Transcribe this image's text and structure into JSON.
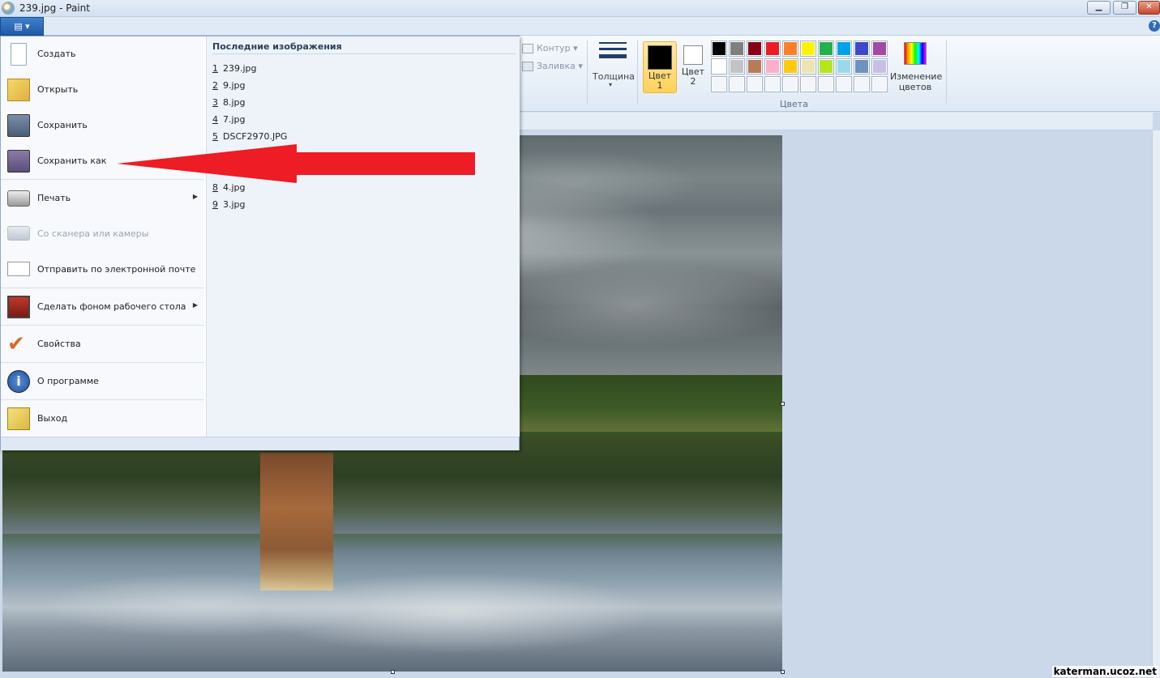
{
  "window": {
    "title": "239.jpg - Paint",
    "minimize_glyph": "▁",
    "restore_glyph": "❐",
    "close_glyph": "✕"
  },
  "ribbon": {
    "file_tab_glyph": "▤ ▾",
    "help_glyph": "?",
    "outline_label": "Контур ▾",
    "fill_label": "Заливка ▾",
    "thickness_label": "Толщина",
    "color1_label": "Цвет 1",
    "color2_label": "Цвет 2",
    "edit_colors_label": "Изменение цветов",
    "colors_group_label": "Цвета",
    "color1_value": "#000000",
    "color2_value": "#ffffff",
    "palette_row1": [
      "#000000",
      "#7f7f7f",
      "#880015",
      "#ed1c24",
      "#ff7f27",
      "#fff200",
      "#22b14c",
      "#00a2e8",
      "#3f48cc",
      "#a349a4"
    ],
    "palette_row2": [
      "#ffffff",
      "#c3c3c3",
      "#b97a57",
      "#ffaec9",
      "#ffc90e",
      "#efe4b0",
      "#b5e61d",
      "#99d9ea",
      "#7092be",
      "#c8bfe7"
    ]
  },
  "file_menu": {
    "items": [
      {
        "label": "Создать",
        "icon": "new-document-icon"
      },
      {
        "label": "Открыть",
        "icon": "open-folder-icon"
      },
      {
        "label": "Сохранить",
        "icon": "save-disk-icon"
      },
      {
        "label": "Сохранить как",
        "icon": "save-as-icon"
      },
      {
        "label": "Печать",
        "icon": "printer-icon"
      },
      {
        "label": "Со сканера или камеры",
        "icon": "scanner-icon"
      },
      {
        "label": "Отправить по электронной почте",
        "icon": "email-icon"
      },
      {
        "label": "Сделать фоном рабочего стола",
        "icon": "desktop-background-icon"
      },
      {
        "label": "Свойства",
        "icon": "checkmark-icon"
      },
      {
        "label": "О программе",
        "icon": "info-icon"
      },
      {
        "label": "Выход",
        "icon": "exit-icon"
      }
    ],
    "recent_header": "Последние изображения",
    "recent_files": [
      {
        "num": "1",
        "name": "239.jpg"
      },
      {
        "num": "2",
        "name": "9.jpg"
      },
      {
        "num": "3",
        "name": "8.jpg"
      },
      {
        "num": "4",
        "name": "7.jpg"
      },
      {
        "num": "5",
        "name": "DSCF2970.JPG"
      },
      {
        "num": "8",
        "name": "4.jpg"
      },
      {
        "num": "9",
        "name": "3.jpg"
      }
    ]
  },
  "watermark": "katerman.ucoz.net"
}
